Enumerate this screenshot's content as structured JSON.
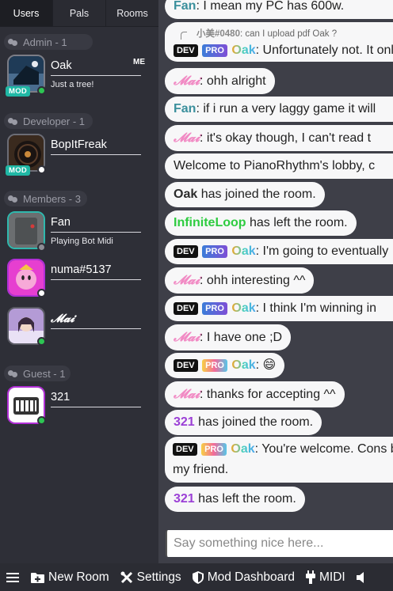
{
  "tabs": [
    "Users",
    "Pals",
    "Rooms"
  ],
  "groups": {
    "admin": "Admin - 1",
    "developer": "Developer - 1",
    "members": "Members - 3",
    "guest": "Guest - 1"
  },
  "users": {
    "oak": {
      "name": "Oak",
      "status": "Just a tree!",
      "badge": "MOD",
      "me": "ME"
    },
    "bopit": {
      "name": "BopItFreak",
      "badge": "MOD"
    },
    "fan": {
      "name": "Fan",
      "status": "Playing Bot Midi"
    },
    "numa": {
      "name": "numa#5137"
    },
    "mai": {
      "name": "𝓜𝓪𝓲"
    },
    "u321": {
      "name": "321"
    }
  },
  "chat": {
    "m0": {
      "name": "Fan",
      "text": ": I mean my PC has 600w."
    },
    "reply": {
      "name": "小美#0480",
      "text": ": can I upload pdf Oak ?"
    },
    "m1": {
      "dev": "DEV",
      "pro": "PRO",
      "name": "Oak",
      "text": ": Unfortunately not. It only s"
    },
    "m2": {
      "name": "𝓜𝓪𝓲",
      "text": ": ohh alright"
    },
    "m3": {
      "name": "Fan",
      "text": ": if i run a very laggy game it will"
    },
    "m4": {
      "name": "𝓜𝓪𝓲",
      "text": ": it's okay though, I can't read t"
    },
    "m5": {
      "text": "Welcome to PianoRhythm's lobby, c"
    },
    "m6": {
      "name": "Oak",
      "text": " has joined the room."
    },
    "m7": {
      "name": "InfiniteLoop",
      "text": " has left the room."
    },
    "m8": {
      "dev": "DEV",
      "pro": "PRO",
      "name": "Oak",
      "text": ": I'm going to eventually"
    },
    "m9": {
      "name": "𝓜𝓪𝓲",
      "text": ": ohh interesting ^^"
    },
    "m10": {
      "dev": "DEV",
      "pro": "PRO",
      "name": "Oak",
      "text": ": I think I'm winning in"
    },
    "m11": {
      "name": "𝓜𝓪𝓲",
      "text": ": I have one ;D"
    },
    "m12": {
      "dev": "DEV",
      "pro": "PRO",
      "name": "Oak",
      "text": ": 😄"
    },
    "m13": {
      "name": "𝓜𝓪𝓲",
      "text": ": thanks for accepting ^^"
    },
    "m14": {
      "name": "321",
      "text": " has joined the room."
    },
    "m15": {
      "dev": "DEV",
      "pro": "PRO",
      "name": "Oak",
      "text": ": You're welcome. Cons be my friend."
    },
    "m16": {
      "name": "321",
      "text": " has left the room."
    }
  },
  "input": {
    "placeholder": "Say something nice here..."
  },
  "bottombar": {
    "new_room": "New Room",
    "settings": "Settings",
    "mod_dashboard": "Mod Dashboard",
    "midi": "MIDI"
  },
  "colors": {
    "mod": "#20b8a5",
    "online": "#2dc653",
    "mai": "#f18ac4",
    "u321": "#9b3fd6",
    "inf": "#2ecc40"
  }
}
